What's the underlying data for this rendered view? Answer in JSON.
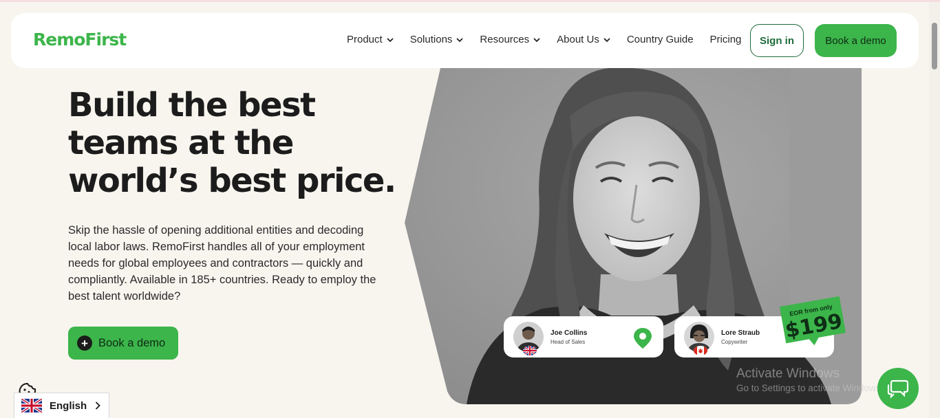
{
  "brand": {
    "logo_text": "RemoFirst",
    "accent_color": "#3cb54a",
    "dark_green": "#1e6b3a"
  },
  "nav": {
    "items": [
      {
        "label": "Product",
        "has_dropdown": true
      },
      {
        "label": "Solutions",
        "has_dropdown": true
      },
      {
        "label": "Resources",
        "has_dropdown": true
      },
      {
        "label": "About Us",
        "has_dropdown": true
      },
      {
        "label": "Country Guide",
        "has_dropdown": false
      },
      {
        "label": "Pricing",
        "has_dropdown": false
      }
    ],
    "signin_label": "Sign in",
    "demo_label": "Book a demo"
  },
  "hero": {
    "title": "Build the best teams at the world’s best price.",
    "description": "Skip the hassle of opening additional entities and decoding local labor laws. RemoFirst handles all of your employment needs for global employees and contractors — quickly and compliantly. Available in 185+ countries. Ready to employ the best talent worldwide?",
    "cta_label": "Book a demo",
    "cta_icon": "plus-circle-icon"
  },
  "cards": [
    {
      "name": "Joe Collins",
      "role": "Head of Sales",
      "flag": "uk-flag-icon",
      "action_icon": "location-pin-icon"
    },
    {
      "name": "Lore Straub",
      "role": "Copywriter",
      "flag": "canada-flag-icon"
    }
  ],
  "price_tag": {
    "caption": "EOR from only",
    "price": "$199"
  },
  "watermark": {
    "line1": "Activate Windows",
    "line2": "Go to Settings to activate Windows."
  },
  "language": {
    "label": "English",
    "flag": "uk-flag-icon"
  },
  "widgets": {
    "chat_icon": "chat-bubble-icon",
    "cookie_icon": "cookie-icon"
  }
}
